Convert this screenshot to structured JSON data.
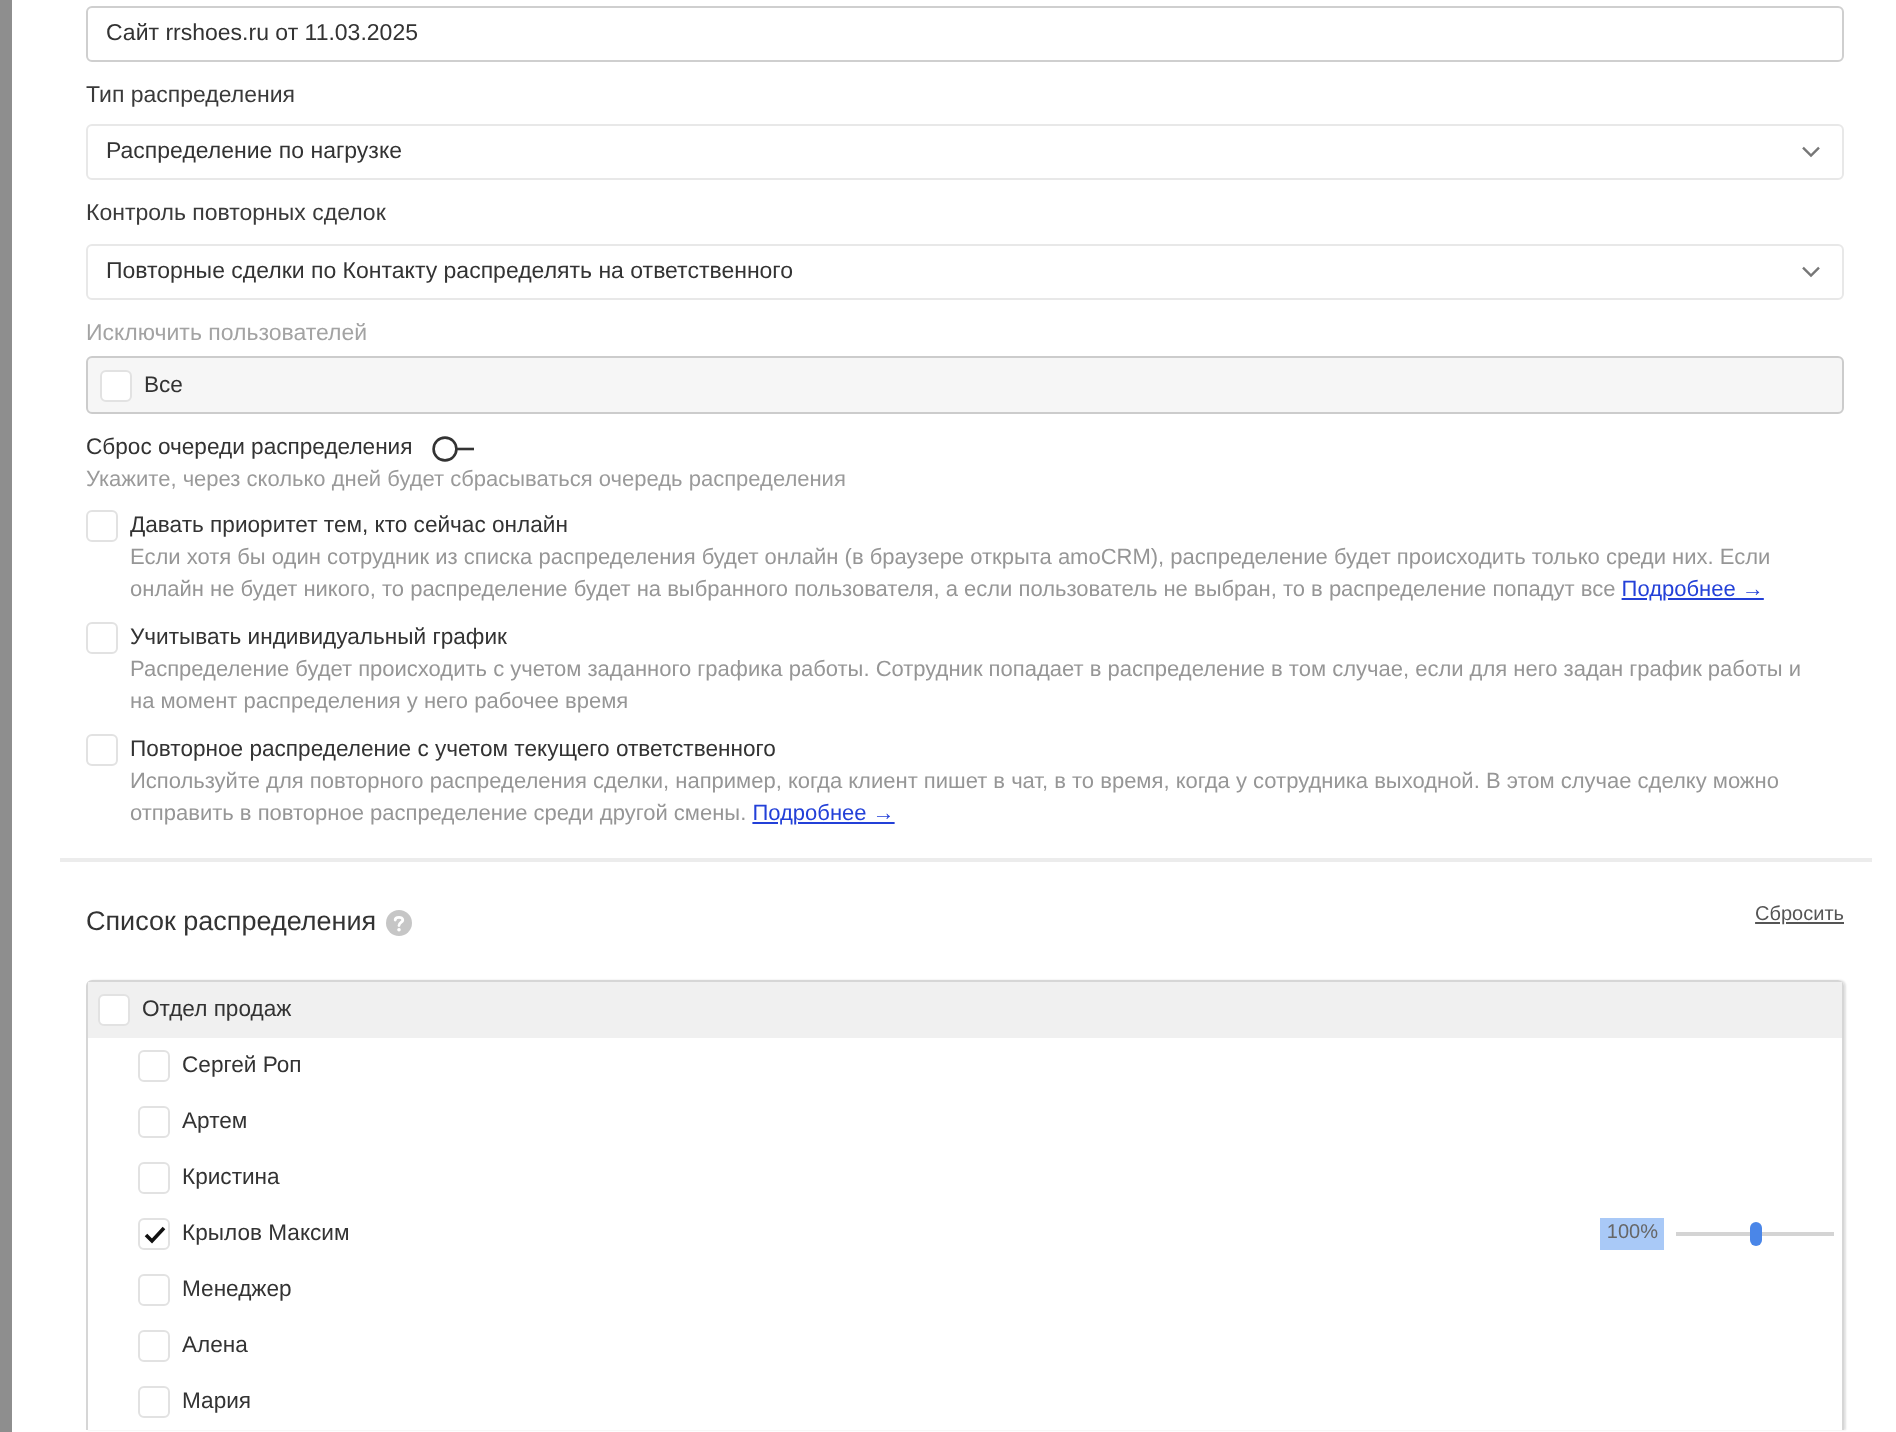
{
  "name_field": {
    "value": "Сайт rrshoes.ru от 11.03.2025"
  },
  "distribution_type": {
    "label": "Тип распределения",
    "value": "Распределение по нагрузке"
  },
  "repeat_deals_control": {
    "label": "Контроль повторных сделок",
    "value": "Повторные сделки по Контакту распределять на ответственного"
  },
  "exclude_users": {
    "label": "Исключить пользователей",
    "disabled": true,
    "option": {
      "label": "Все",
      "checked": false
    }
  },
  "queue_reset": {
    "label": "Сброс очереди распределения",
    "on": false,
    "hint": "Укажите, через сколько дней будет сбрасываться очередь распределения"
  },
  "options": [
    {
      "title": "Давать приоритет тем, кто сейчас онлайн",
      "checked": false,
      "description": "Если хотя бы один сотрудник из списка распределения будет онлайн (в браузере открыта amoCRM), распределение будет происходить только среди них. Если онлайн не будет никого, то распределение будет на выбранного пользователя, а если пользователь не выбран, то в распределение попадут все",
      "link": "Подробнее →"
    },
    {
      "title": "Учитывать индивидуальный график",
      "checked": false,
      "description": "Распределение будет происходить с учетом заданного графика работы. Сотрудник попадает в распределение в том случае, если для него задан график работы и на момент распределения у него рабочее время"
    },
    {
      "title": "Повторное распределение с учетом текущего ответственного",
      "checked": false,
      "description": "Используйте для повторного распределения сделки, например, когда клиент пишет в чат, в то время, когда у сотрудника выходной. В этом случае сделку можно отправить в повторное распределение среди другой смены.",
      "link": "Подробнее →"
    }
  ],
  "distribution_list": {
    "title": "Список распределения",
    "reset_link": "Сбросить",
    "groups": [
      {
        "name": "Отдел продаж",
        "checked": false,
        "children": [
          {
            "name": "Сергей Роп",
            "checked": false
          },
          {
            "name": "Артем",
            "checked": false
          },
          {
            "name": "Кристина",
            "checked": false
          },
          {
            "name": "Крылов Максим",
            "checked": true,
            "share": "100%",
            "level": 0.5
          },
          {
            "name": "Менеджер",
            "checked": false
          },
          {
            "name": "Алена",
            "checked": false
          },
          {
            "name": "Мария",
            "checked": false
          }
        ]
      }
    ]
  }
}
